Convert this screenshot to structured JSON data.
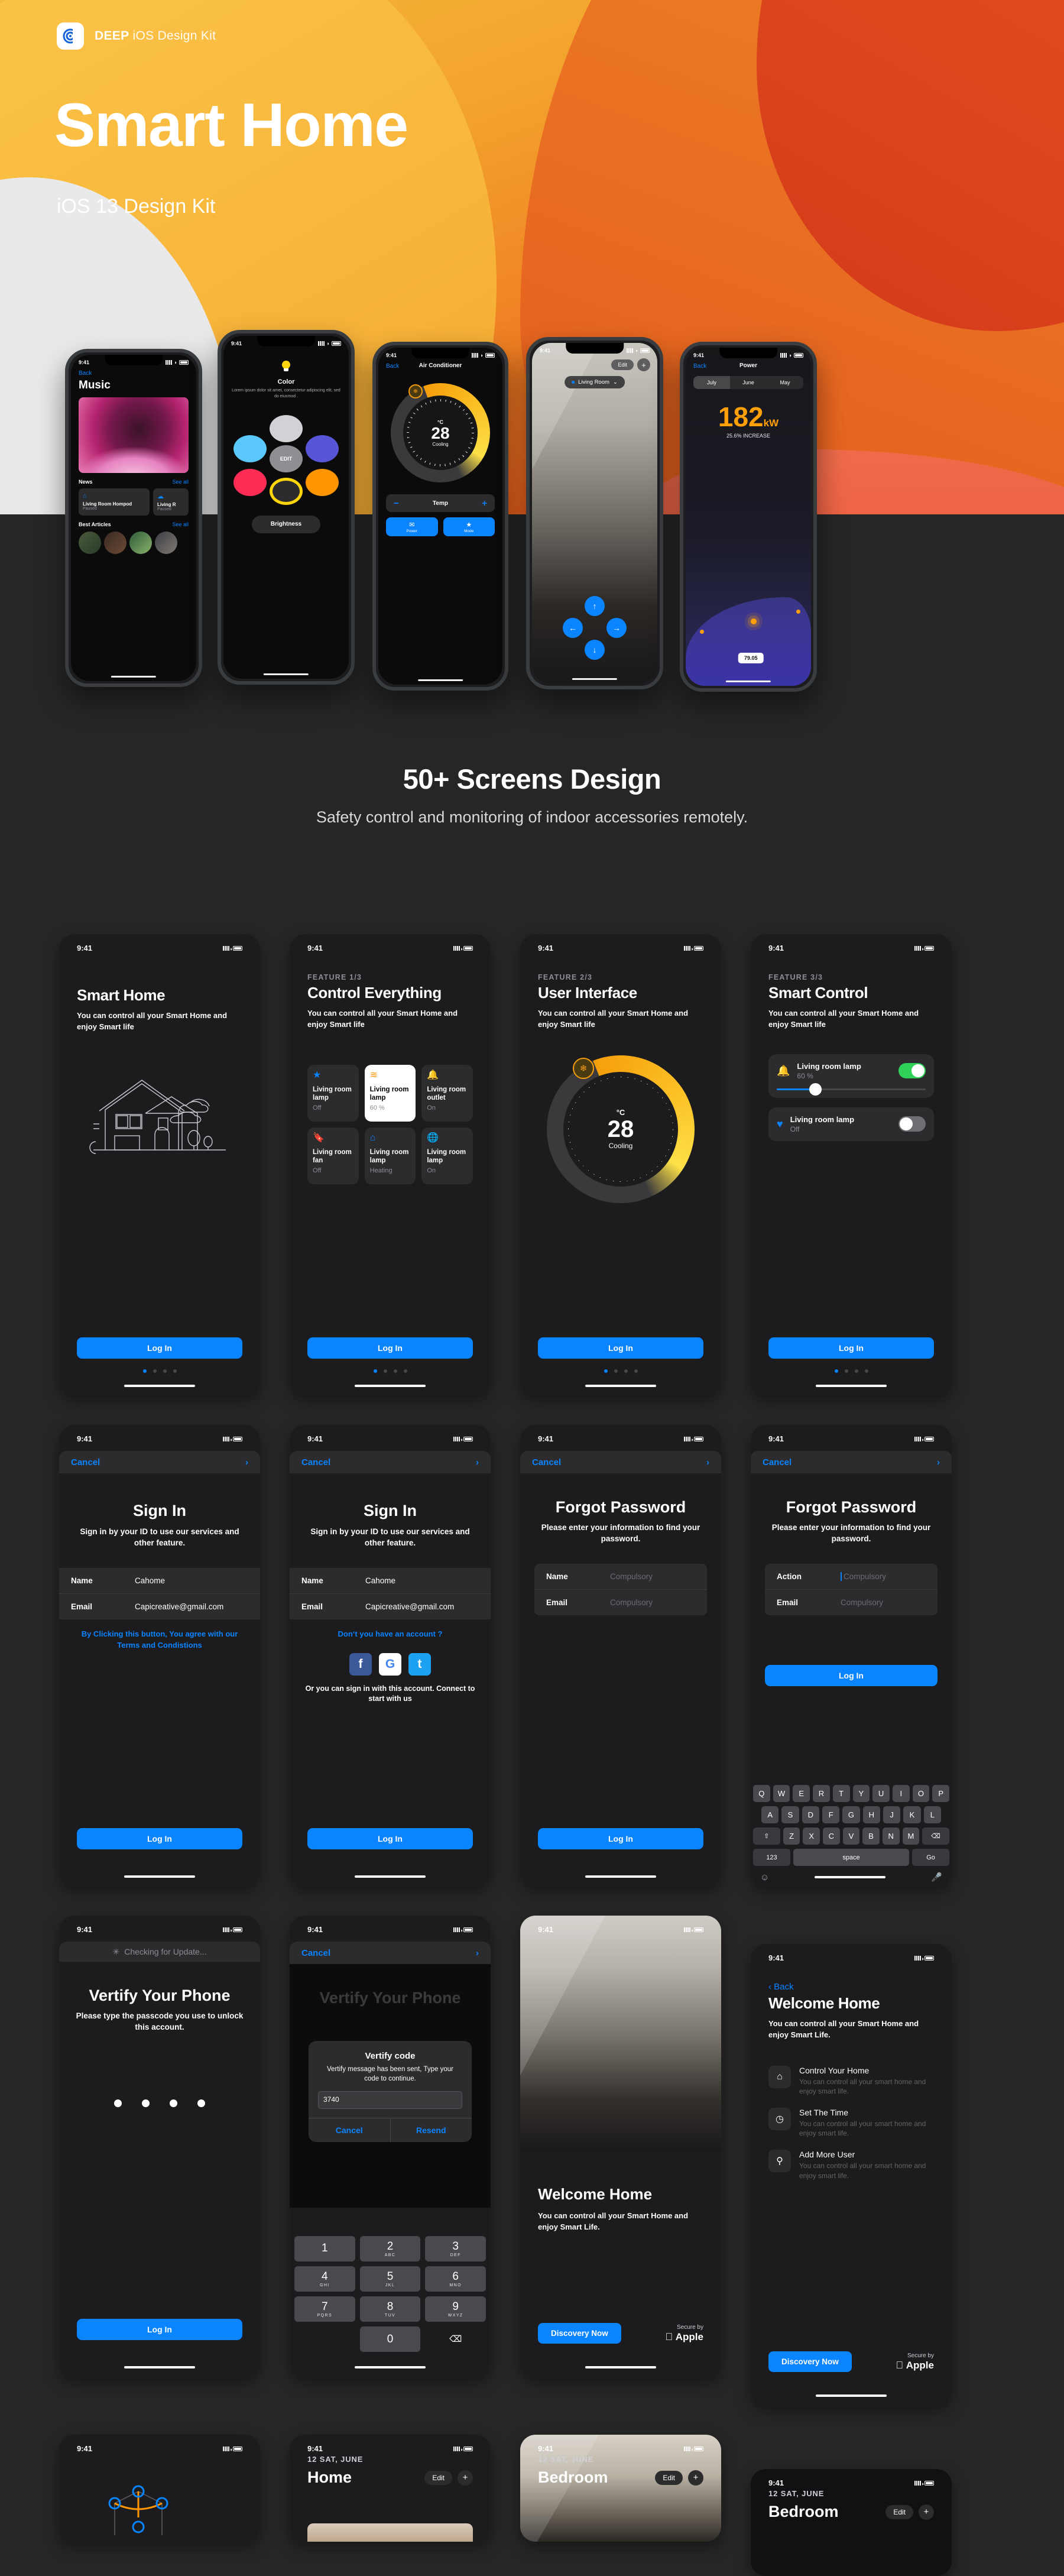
{
  "hero": {
    "brand_bold": "DEEP",
    "brand_light": "iOS Design Kit",
    "title": "Smart Home",
    "subtitle": "iOS 13 Design Kit",
    "accent": "#f59e0b"
  },
  "section": {
    "heading": "50+ Screens Design",
    "subheading": "Safety control and monitoring of indoor accessories remotely."
  },
  "status": {
    "time": "9:41"
  },
  "common": {
    "login": "Log In",
    "back": "Back",
    "cancel": "Cancel",
    "discovery": "Discovery Now",
    "secure_small": "Secure by",
    "secure_brand": "Apple",
    "desc": "You can control all your Smart Home and enjoy Smart life",
    "desc_life": "You can control all your Smart Home and enjoy Smart Life."
  },
  "mockups": {
    "music": {
      "back": "Back",
      "title": "Music",
      "news_label": "News",
      "see_all": "See all",
      "card_title": "Living Room Hompod",
      "card_status": "Paused",
      "card2_title": "Living R",
      "card2_status": "Paused",
      "articles_label": "Best Articles"
    },
    "color": {
      "title": "Color",
      "desc": "Lorem ipsum dolor sit amet, consectetur adipiscing elit, sed do eiusmod .",
      "edit": "EDIT",
      "brightness": "Brightness",
      "swatches": [
        "#d1d1d6",
        "#5ac8fa",
        "#5856d6",
        "#ff2d55",
        "#ff9500",
        "#ffd60a"
      ]
    },
    "ac": {
      "back": "Back",
      "title": "Air Conditioner",
      "unit": "°C",
      "value": "28",
      "mode": "Cooling",
      "temp_label": "Temp",
      "minus": "−",
      "plus": "+",
      "btn1": "Power",
      "btn2": "Mode"
    },
    "camera": {
      "edit": "Edit",
      "add": "+",
      "room": "Living Room"
    },
    "power": {
      "back": "Back",
      "title": "Power",
      "months": [
        "July",
        "June",
        "May"
      ],
      "active_month": "July",
      "value": "182",
      "unit": "kW",
      "delta": "25.6% INCREASE",
      "point_label": "79.05"
    }
  },
  "screens": {
    "onboard1": {
      "title": "Smart Home",
      "desc": "You can control all your Smart Home and enjoy Smart life",
      "cta": "Log In"
    },
    "onboard2": {
      "eyebrow": "FEATURE 1/3",
      "title": "Control Everything",
      "desc": "You can control all your Smart Home and enjoy Smart life",
      "cta": "Log In",
      "tiles": [
        {
          "icon": "star-icon",
          "glyph": "★",
          "name": "Living room lamp",
          "status": "Off",
          "highlight": false
        },
        {
          "icon": "layers-icon",
          "glyph": "◆",
          "name": "Living room lamp",
          "status": "60 %",
          "highlight": true
        },
        {
          "icon": "bell-icon",
          "glyph": "🔔",
          "name": "Living room outlet",
          "status": "On",
          "highlight": false
        },
        {
          "icon": "bookmark-icon",
          "glyph": "🔖",
          "name": "Living room fan",
          "status": "Off",
          "highlight": false
        },
        {
          "icon": "home-icon",
          "glyph": "⌂",
          "name": "Living room lamp",
          "status": "Heating",
          "highlight": false
        },
        {
          "icon": "globe-icon",
          "glyph": "🌐",
          "name": "Living room lamp",
          "status": "On",
          "highlight": false
        }
      ]
    },
    "onboard3": {
      "eyebrow": "FEATURE 2/3",
      "title": "User Interface",
      "desc": "You can control all your Smart Home and enjoy Smart life",
      "cta": "Log In",
      "unit": "°C",
      "value": "28",
      "mode": "Cooling"
    },
    "onboard4": {
      "eyebrow": "FEATURE 3/3",
      "title": "Smart Control",
      "desc": "You can control all your Smart Home and enjoy Smart life",
      "cta": "Log In",
      "rows": [
        {
          "icon": "bell-icon",
          "glyph": "🔔",
          "name": "Living room lamp",
          "status": "60 %",
          "on": true,
          "slider": true
        },
        {
          "icon": "heart-icon",
          "glyph": "♥",
          "name": "Living room lamp",
          "status": "Off",
          "on": false,
          "slider": false
        }
      ]
    },
    "signin1": {
      "cancel": "Cancel",
      "title": "Sign In",
      "desc": "Sign in by your ID to use our services and other feature.",
      "name_label": "Name",
      "name_value": "Cahome",
      "email_label": "Email",
      "email_value": "Capicreative@gmail.com",
      "terms": "By Clicking this button, You agree with our Terms and Condistions",
      "cta": "Log In"
    },
    "signin2": {
      "cancel": "Cancel",
      "title": "Sign In",
      "desc": "Sign in by your ID to use our services and other feature.",
      "name_label": "Name",
      "name_value": "Cahome",
      "email_label": "Email",
      "email_value": "Capicreative@gmail.com",
      "no_account": "Don‘t you have an account ?",
      "socials": [
        "f",
        "G",
        "t"
      ],
      "social_note": "Or you can sign in with this account. Connect to start with us",
      "cta": "Log In"
    },
    "forgot1": {
      "cancel": "Cancel",
      "title": "Forgot Password",
      "desc": "Please enter your information to find your password.",
      "name_label": "Name",
      "name_placeholder": "Compulsory",
      "email_label": "Email",
      "email_placeholder": "Compulsory",
      "cta": "Log In"
    },
    "forgot2": {
      "cancel": "Cancel",
      "title": "Forgot Password",
      "desc": "Please enter your information to find your password.",
      "action_label": "Action",
      "action_placeholder": "Compulsory",
      "email_label": "Email",
      "email_placeholder": "Compulsory",
      "cta": "Log In",
      "keyboard": {
        "row1": [
          "Q",
          "W",
          "E",
          "R",
          "T",
          "Y",
          "U",
          "I",
          "O",
          "P"
        ],
        "row2": [
          "A",
          "S",
          "D",
          "F",
          "G",
          "H",
          "J",
          "K",
          "L"
        ],
        "row3": [
          "⇧",
          "Z",
          "X",
          "C",
          "V",
          "B",
          "N",
          "M",
          "⌫"
        ],
        "row4": [
          "123",
          "space",
          "Go"
        ],
        "emoji": "☺",
        "mic": "🎤"
      }
    },
    "verify1": {
      "updating": "Checking for Update...",
      "title": "Vertify Your Phone",
      "desc": "Please type the passcode you use to unlock this account.",
      "cta": "Log In"
    },
    "verify2": {
      "cancel": "Cancel",
      "title": "Vertify Your Phone",
      "dialog_title": "Vertify code",
      "dialog_msg": "Vertify message has been sent, Type your code to continue.",
      "code": "3740",
      "dialog_cancel": "Cancel",
      "dialog_resend": "Resend",
      "keys": [
        {
          "d": "1",
          "l": ""
        },
        {
          "d": "2",
          "l": "ABC"
        },
        {
          "d": "3",
          "l": "DEF"
        },
        {
          "d": "4",
          "l": "GHI"
        },
        {
          "d": "5",
          "l": "JKL"
        },
        {
          "d": "6",
          "l": "MNO"
        },
        {
          "d": "7",
          "l": "PQRS"
        },
        {
          "d": "8",
          "l": "TUV"
        },
        {
          "d": "9",
          "l": "WXYZ"
        },
        {
          "d": "0",
          "l": ""
        },
        {
          "d": "⌫",
          "l": ""
        }
      ]
    },
    "welcome1": {
      "title": "Welcome Home",
      "desc": "You can control all your Smart Home and enjoy Smart Life.",
      "cta": "Discovery Now",
      "secure_small": "Secure by",
      "secure_brand": "Apple"
    },
    "welcome2": {
      "back": "Back",
      "title": "Welcome Home",
      "desc": "You can control all your Smart Home and enjoy Smart Life.",
      "features": [
        {
          "icon": "home-icon",
          "glyph": "⌂",
          "title": "Control Your Home",
          "desc": "You can control all your smart home and enjoy smart life."
        },
        {
          "icon": "clock-icon",
          "glyph": "◷",
          "title": "Set The Time",
          "desc": "You can control all your smart home and enjoy smart life."
        },
        {
          "icon": "add-user-icon",
          "glyph": "⚲",
          "title": "Add More User",
          "desc": "You can control all your smart home and enjoy smart life."
        }
      ],
      "cta": "Discovery Now",
      "secure_small": "Secure by",
      "secure_brand": "Apple"
    },
    "bottom1": {
      "label": ""
    },
    "bottom2": {
      "date": "12 SAT, JUNE",
      "title": "Home",
      "edit": "Edit",
      "add": "+"
    },
    "bottom3": {
      "date": "12 SAT, JUNE",
      "title": "Bedroom",
      "edit": "Edit",
      "add": "+"
    },
    "bottom4": {
      "date": "12 SAT, JUNE",
      "title": "Bedroom",
      "edit": "Edit",
      "add": "+"
    }
  }
}
